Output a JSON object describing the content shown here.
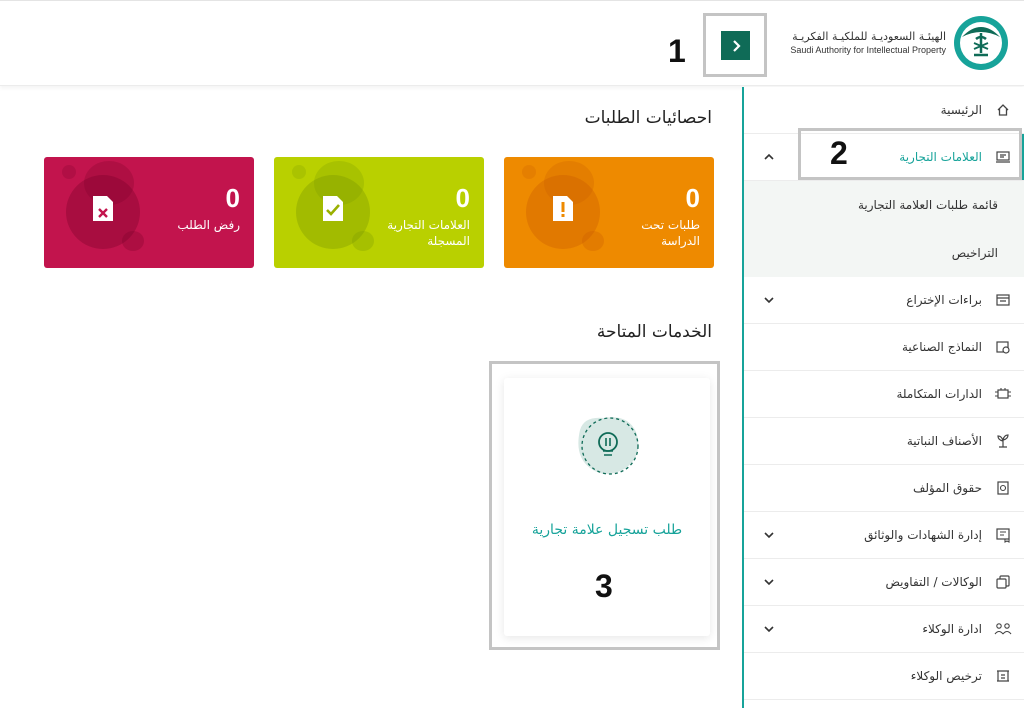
{
  "header": {
    "logo_ar": "الهيئـة السعوديـة للملكيـة الفكريـة",
    "logo_en": "Saudi Authority for Intellectual Property",
    "toggle_icon": "chevron-right-icon"
  },
  "callouts": [
    "1",
    "2",
    "3"
  ],
  "sidebar": {
    "items": [
      {
        "label": "الرئيسية",
        "icon": "home-icon"
      },
      {
        "label": "العلامات التجارية",
        "icon": "trademark-icon",
        "expanded": true
      },
      {
        "label": "براءات الإختراع",
        "icon": "patent-icon",
        "has_children": true
      },
      {
        "label": "النماذج الصناعية",
        "icon": "industrial-design-icon"
      },
      {
        "label": "الدارات المتكاملة",
        "icon": "circuit-icon"
      },
      {
        "label": "الأصناف النباتية",
        "icon": "plant-icon"
      },
      {
        "label": "حقوق المؤلف",
        "icon": "copyright-icon"
      },
      {
        "label": "إدارة الشهادات والوثائق",
        "icon": "certificate-icon",
        "has_children": true
      },
      {
        "label": "الوكالات / التفاويض",
        "icon": "agency-icon",
        "has_children": true
      },
      {
        "label": "ادارة الوكلاء",
        "icon": "agents-icon",
        "has_children": true
      },
      {
        "label": "ترخيص الوكلاء",
        "icon": "agent-license-icon"
      }
    ],
    "submenu": [
      {
        "label": "قائمة طلبات العلامة التجارية"
      },
      {
        "label": "التراخيص"
      }
    ]
  },
  "stats": {
    "title": "احصائيات الطلبات",
    "cards": [
      {
        "count": "0",
        "label": "طلبات تحت الدراسة",
        "color": "#ee8a00",
        "icon": "document-alert-icon"
      },
      {
        "count": "0",
        "label": "العلامات التجارية المسجلة",
        "color": "#b9d000",
        "icon": "document-check-icon"
      },
      {
        "count": "0",
        "label": "رفض الطلب",
        "color": "#c2144d",
        "icon": "document-reject-icon"
      }
    ]
  },
  "services": {
    "title": "الخدمات المتاحة",
    "items": [
      {
        "label": "طلب تسجيل علامة تجارية",
        "icon": "lightbulb-icon"
      }
    ]
  },
  "colors": {
    "brand": "#17a39a",
    "dark": "#0f6b57"
  }
}
